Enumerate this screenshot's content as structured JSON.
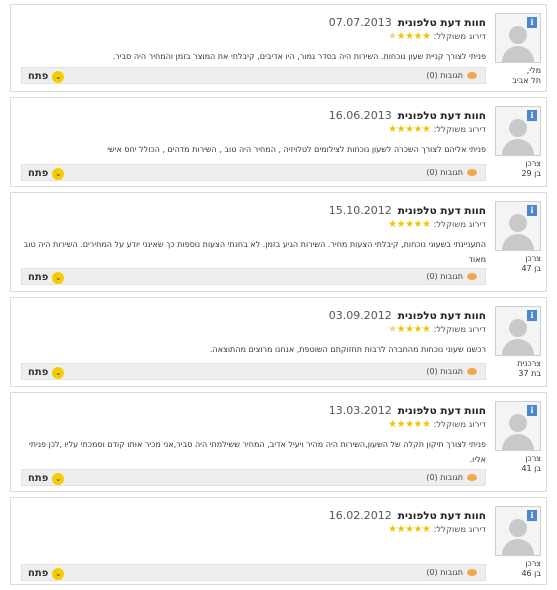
{
  "reviews": [
    {
      "title": "חוות דעת טלפונית",
      "date": "07.07.2013",
      "rating_label": "דירוג משוקלל:",
      "rating": 4,
      "text": "פניתי לצורך קניית שעון נוכחות. השירות היה בסדר גמור, היו אדיבים, קיבלתי את המוצר בזמן והמחיר היה סביר.",
      "comments_label": "תגובות (0)",
      "open_label": "פתח",
      "user_name": "מלי,",
      "user_detail": "תל אביב"
    },
    {
      "title": "חוות דעת טלפונית",
      "date": "16.06.2013",
      "rating_label": "דירוג משוקלל:",
      "rating": 5,
      "text": "פניתי אליהם לצורך השכרה לשעון נוכחות לצילומים לטלויזיה , המחיר היה טוב , השירות מדהים , הכולל יחס אישי",
      "comments_label": "תגובות (0)",
      "open_label": "פתח",
      "user_name": "צרכן",
      "user_detail": "בן 29"
    },
    {
      "title": "חוות דעת טלפונית",
      "date": "15.10.2012",
      "rating_label": "דירוג משוקלל:",
      "rating": 5,
      "text": "התעניינתי בשעוני נוכחות, קיבלתי הצעות מחיר. השירות הגיע בזמן. לא בחנתי הצעות נוספות כך שאינני יודע על המחירים. השירות היה טוב מאוד",
      "comments_label": "תגובות (0)",
      "open_label": "פתח",
      "user_name": "צרכן",
      "user_detail": "בן 47"
    },
    {
      "title": "חוות דעת טלפונית",
      "date": "03.09.2012",
      "rating_label": "דירוג משוקלל:",
      "rating": 4,
      "text": "רכשנו שעוני נוכחות מהחברה לרבות תחזוקתם השוטפת, אנחנו מרוצים מהתוצאה.",
      "comments_label": "תגובות (0)",
      "open_label": "פתח",
      "user_name": "צרכנית",
      "user_detail": "בת 37"
    },
    {
      "title": "חוות דעת טלפונית",
      "date": "13.03.2012",
      "rating_label": "דירוג משוקלל:",
      "rating": 5,
      "text": "פניתי לצורך תיקון תקלה של השעון,השירות היה מהיר ויעיל אדיב, המחיר ששילמתי היה סביר,אני מכיר אותו קודם וסמכתי עליו ,לכן פניתי אליו.",
      "comments_label": "תגובות (0)",
      "open_label": "פתח",
      "user_name": "צרכן",
      "user_detail": "בן 41"
    },
    {
      "title": "חוות דעת טלפונית",
      "date": "16.02.2012",
      "rating_label": "דירוג משוקלל:",
      "rating": 5,
      "text": "",
      "comments_label": "תגובות (0)",
      "open_label": "פתח",
      "user_name": "צרכן",
      "user_detail": "בן 46"
    }
  ]
}
